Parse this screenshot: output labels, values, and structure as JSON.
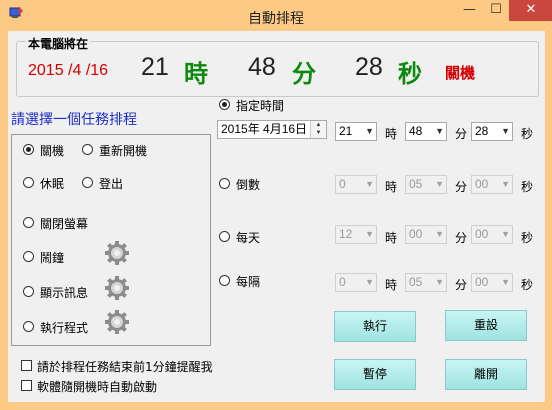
{
  "window": {
    "title": "自動排程",
    "min_glyph": "—",
    "max_glyph": "☐",
    "close_glyph": "✕"
  },
  "clock": {
    "label": "本電腦將在",
    "date": "2015 /4 /16",
    "hour": "21",
    "hour_unit": "時",
    "minute": "48",
    "minute_unit": "分",
    "second": "28",
    "second_unit": "秒",
    "action": "關機"
  },
  "tasks": {
    "title": "請選擇一個任務排程",
    "options": [
      {
        "label": "關機",
        "selected": true
      },
      {
        "label": "重新開機",
        "selected": false
      },
      {
        "label": "休眠",
        "selected": false
      },
      {
        "label": "登出",
        "selected": false
      },
      {
        "label": "關閉螢幕",
        "selected": false
      },
      {
        "label": "鬧鐘",
        "selected": false
      },
      {
        "label": "顯示訊息",
        "selected": false
      },
      {
        "label": "執行程式",
        "selected": false
      }
    ]
  },
  "checkboxes": [
    {
      "label": "請於排程任務結束前1分鐘提醒我",
      "checked": false
    },
    {
      "label": "軟體隨開機時自動啟動",
      "checked": false
    }
  ],
  "schedule": {
    "modes": [
      {
        "label": "指定時間",
        "selected": true
      },
      {
        "label": "倒數",
        "selected": false
      },
      {
        "label": "每天",
        "selected": false
      },
      {
        "label": "每隔",
        "selected": false
      }
    ],
    "date_picker": "2015年  4月16日",
    "units": {
      "hour": "時",
      "minute": "分",
      "second": "秒"
    },
    "rows": [
      {
        "hour": "21",
        "minute": "48",
        "second": "28",
        "enabled": true
      },
      {
        "hour": "0",
        "minute": "05",
        "second": "00",
        "enabled": false
      },
      {
        "hour": "12",
        "minute": "00",
        "second": "00",
        "enabled": false
      },
      {
        "hour": "0",
        "minute": "05",
        "second": "00",
        "enabled": false
      }
    ]
  },
  "buttons": {
    "execute": "執行",
    "reset": "重設",
    "pause": "暫停",
    "leave": "離開"
  },
  "colors": {
    "frame": "#fdca86",
    "date_red": "#d40000",
    "unit_green": "#0d8a0d",
    "task_title_blue": "#1c2ec7",
    "button_cyan": "#9fe3e1"
  }
}
